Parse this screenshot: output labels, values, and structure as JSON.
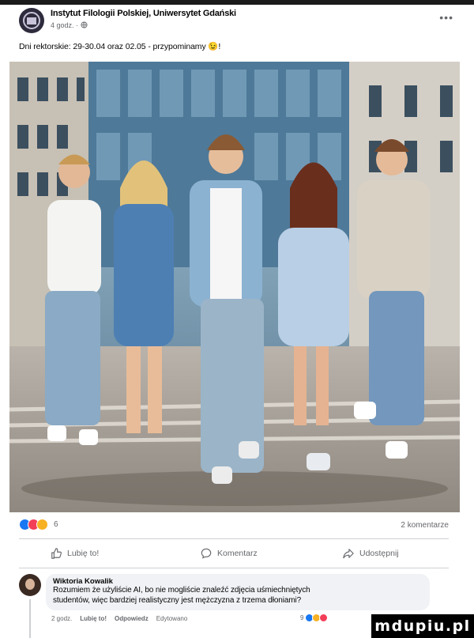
{
  "post": {
    "author": "Instytut Filologii Polskiej, Uniwersytet Gdański",
    "time": "4 godz.",
    "more_icon": "ellipsis-icon",
    "caption": "Dni rektorskie:  29-30.04 oraz 02.05 - przypominamy 😉!",
    "photo_icon": "group-photo"
  },
  "engagement": {
    "reaction_count": "6",
    "comments_count": "2 komentarze"
  },
  "actions": {
    "like_label": "Lubię to!",
    "comment_label": "Komentarz",
    "share_label": "Udostępnij"
  },
  "comment": {
    "author": "Wiktoria Kowalik",
    "line1": "Rozumiem że użyliście AI, bo nie mogliście znaleźć zdjęcia uśmiechniętych",
    "line2": "studentów, więc bardziej realistyczny jest mężczyzna z trzema dłoniami?",
    "time": "2 godz.",
    "like_link": "Lubię to!",
    "reply_link": "Odpowiedz",
    "edited": "Edytowano",
    "reaction_count": "9"
  },
  "watermark": "mdupiu.pl",
  "colors": {
    "like": "#1877f2",
    "love": "#f33e58",
    "haha": "#f7b125",
    "secondary_text": "#65676b"
  }
}
